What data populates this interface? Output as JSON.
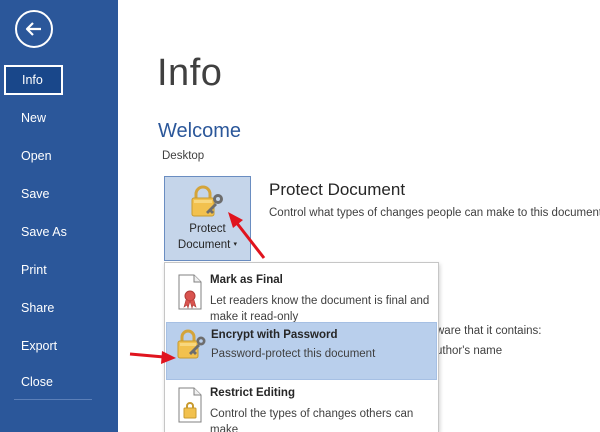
{
  "sidebar": {
    "back_label": "Back",
    "items": [
      {
        "label": "Info",
        "selected": true
      },
      {
        "label": "New"
      },
      {
        "label": "Open"
      },
      {
        "label": "Save"
      },
      {
        "label": "Save As"
      },
      {
        "label": "Print"
      },
      {
        "label": "Share"
      },
      {
        "label": "Export"
      },
      {
        "label": "Close"
      }
    ]
  },
  "main": {
    "page_title": "Info",
    "doc_title": "Welcome",
    "doc_location": "Desktop",
    "protect_button": {
      "line1": "Protect",
      "line2": "Document",
      "caret": "▾"
    },
    "section_heading": "Protect Document",
    "section_description": "Control what types of changes people can make to this document.",
    "behind_text_1": "ware that it contains:",
    "behind_text_2": "uthor's name"
  },
  "menu": {
    "items": [
      {
        "title": "Mark as Final",
        "description": "Let readers know the document is final and make it read-only",
        "icon": "ribbon-document-icon"
      },
      {
        "title": "Encrypt with Password",
        "description": "Password-protect this document",
        "icon": "lock-key-icon",
        "highlighted": true
      },
      {
        "title": "Restrict Editing",
        "description": "Control the types of changes others can make",
        "icon": "lock-document-icon"
      }
    ]
  },
  "colors": {
    "sidebar_bg": "#2b579a",
    "accent": "#2b579a",
    "highlight": "#b9cfec",
    "arrow": "#e0141e"
  }
}
